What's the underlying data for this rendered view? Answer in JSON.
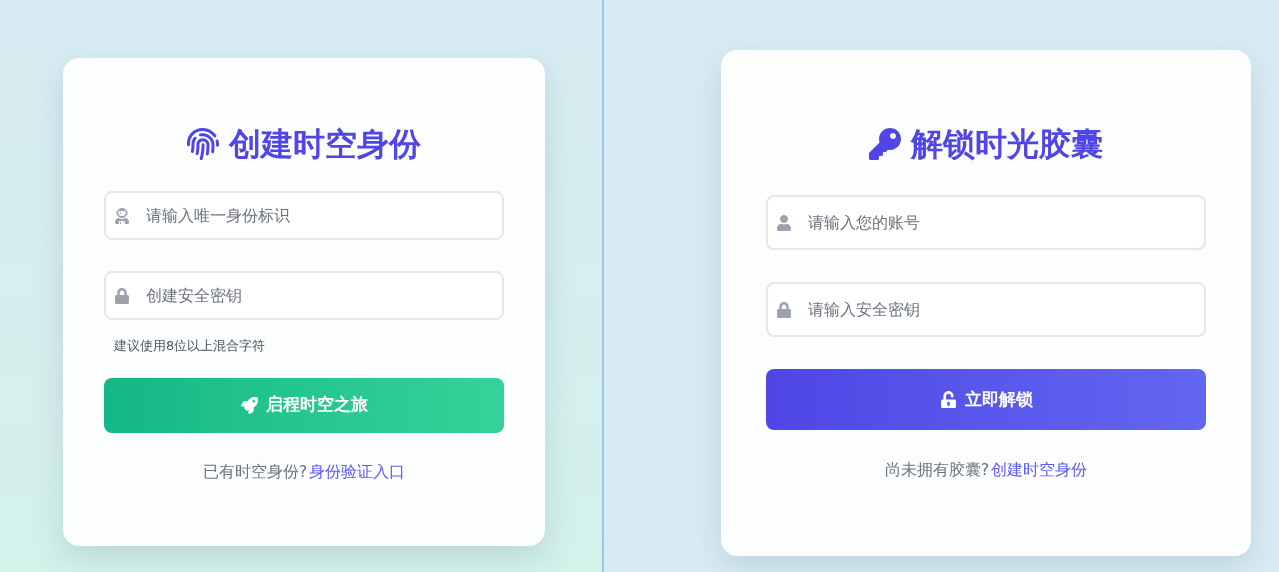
{
  "panels": [
    {
      "kind": "register",
      "title": "创建时空身份",
      "fields": [
        {
          "kind": "identity",
          "placeholder": "请输入唯一身份标识"
        },
        {
          "kind": "password",
          "placeholder": "创建安全密钥"
        }
      ],
      "hint": "建议使用8位以上混合字符",
      "button": "启程时空之旅",
      "footer": {
        "text": "已有时空身份?",
        "link": "身份验证入口"
      }
    },
    {
      "kind": "login",
      "title": "解锁时光胶囊",
      "fields": [
        {
          "kind": "user",
          "placeholder": "请输入您的账号"
        },
        {
          "kind": "password",
          "placeholder": "请输入安全密钥"
        }
      ],
      "button": "立即解锁",
      "footer": {
        "text": "尚未拥有胶囊?",
        "link": "创建时空身份"
      }
    }
  ]
}
